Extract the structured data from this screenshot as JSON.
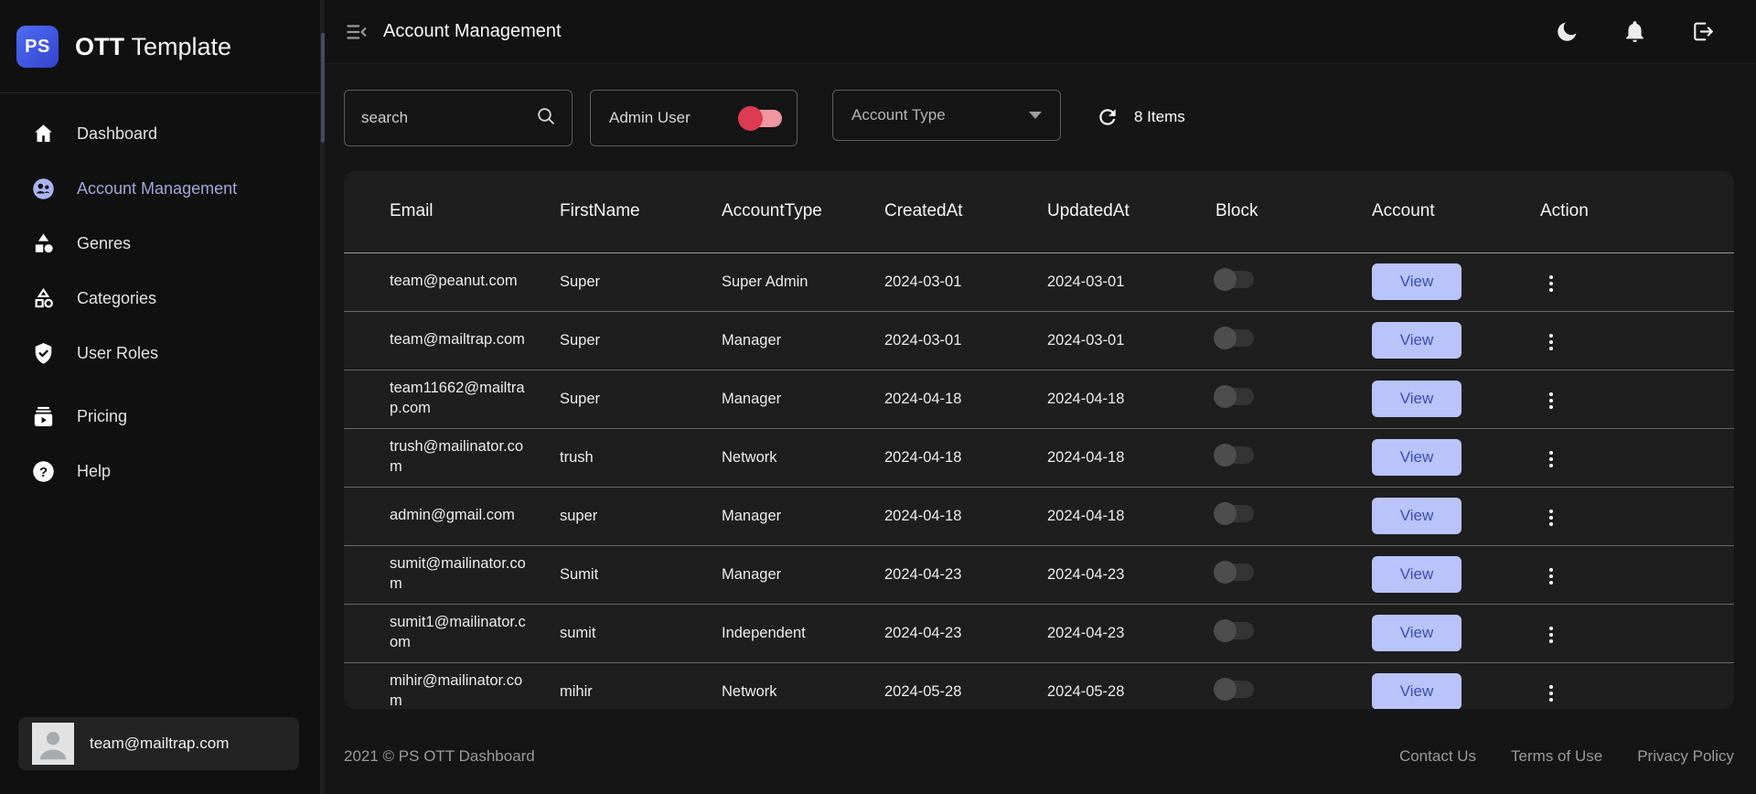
{
  "brand": {
    "logo_text": "PS",
    "title_bold": "OTT",
    "title_regular": "Template"
  },
  "sidebar": {
    "items": [
      {
        "label": "Dashboard",
        "icon": "home-icon",
        "active": false
      },
      {
        "label": "Account Management",
        "icon": "account-management-icon",
        "active": true
      },
      {
        "label": "Genres",
        "icon": "genres-icon",
        "active": false
      },
      {
        "label": "Categories",
        "icon": "categories-icon",
        "active": false
      },
      {
        "label": "User Roles",
        "icon": "user-roles-icon",
        "active": false
      },
      {
        "label": "Pricing",
        "icon": "pricing-icon",
        "active": false
      },
      {
        "label": "Help",
        "icon": "help-icon",
        "active": false
      }
    ],
    "user": {
      "email": "team@mailtrap.com"
    }
  },
  "header": {
    "title": "Account Management"
  },
  "filters": {
    "search_placeholder": "search",
    "admin_user_label": "Admin User",
    "admin_user_on": true,
    "account_type_label": "Account Type",
    "items_count": "8 Items"
  },
  "table": {
    "columns": [
      "Email",
      "FirstName",
      "AccountType",
      "CreatedAt",
      "UpdatedAt",
      "Block",
      "Account",
      "Action"
    ],
    "view_label": "View",
    "rows": [
      {
        "email": "team@peanut.com",
        "first_name": "Super",
        "account_type": "Super Admin",
        "created_at": "2024-03-01",
        "updated_at": "2024-03-01",
        "blocked": false
      },
      {
        "email": "team@mailtrap.com",
        "first_name": "Super",
        "account_type": "Manager",
        "created_at": "2024-03-01",
        "updated_at": "2024-03-01",
        "blocked": false
      },
      {
        "email": "team11662@mailtrap.com",
        "first_name": "Super",
        "account_type": "Manager",
        "created_at": "2024-04-18",
        "updated_at": "2024-04-18",
        "blocked": false
      },
      {
        "email": "trush@mailinator.com",
        "first_name": "trush",
        "account_type": "Network",
        "created_at": "2024-04-18",
        "updated_at": "2024-04-18",
        "blocked": false
      },
      {
        "email": "admin@gmail.com",
        "first_name": "super",
        "account_type": "Manager",
        "created_at": "2024-04-18",
        "updated_at": "2024-04-18",
        "blocked": false
      },
      {
        "email": "sumit@mailinator.com",
        "first_name": "Sumit",
        "account_type": "Manager",
        "created_at": "2024-04-23",
        "updated_at": "2024-04-23",
        "blocked": false
      },
      {
        "email": "sumit1@mailinator.com",
        "first_name": "sumit",
        "account_type": "Independent",
        "created_at": "2024-04-23",
        "updated_at": "2024-04-23",
        "blocked": false
      },
      {
        "email": "mihir@mailinator.com",
        "first_name": "mihir",
        "account_type": "Network",
        "created_at": "2024-05-28",
        "updated_at": "2024-05-28",
        "blocked": false
      }
    ]
  },
  "footer": {
    "copyright": "2021 © PS OTT Dashboard",
    "links": [
      "Contact Us",
      "Terms of Use",
      "Privacy Policy"
    ]
  },
  "colors": {
    "accent_periwinkle": "#9fa8da",
    "view_button_bg": "#b8c4fa",
    "view_button_text": "#3c4db0",
    "toggle_on_knob": "#dc3b51",
    "toggle_on_track": "#ef96a1",
    "logo_blue": "#4a5cf0"
  }
}
